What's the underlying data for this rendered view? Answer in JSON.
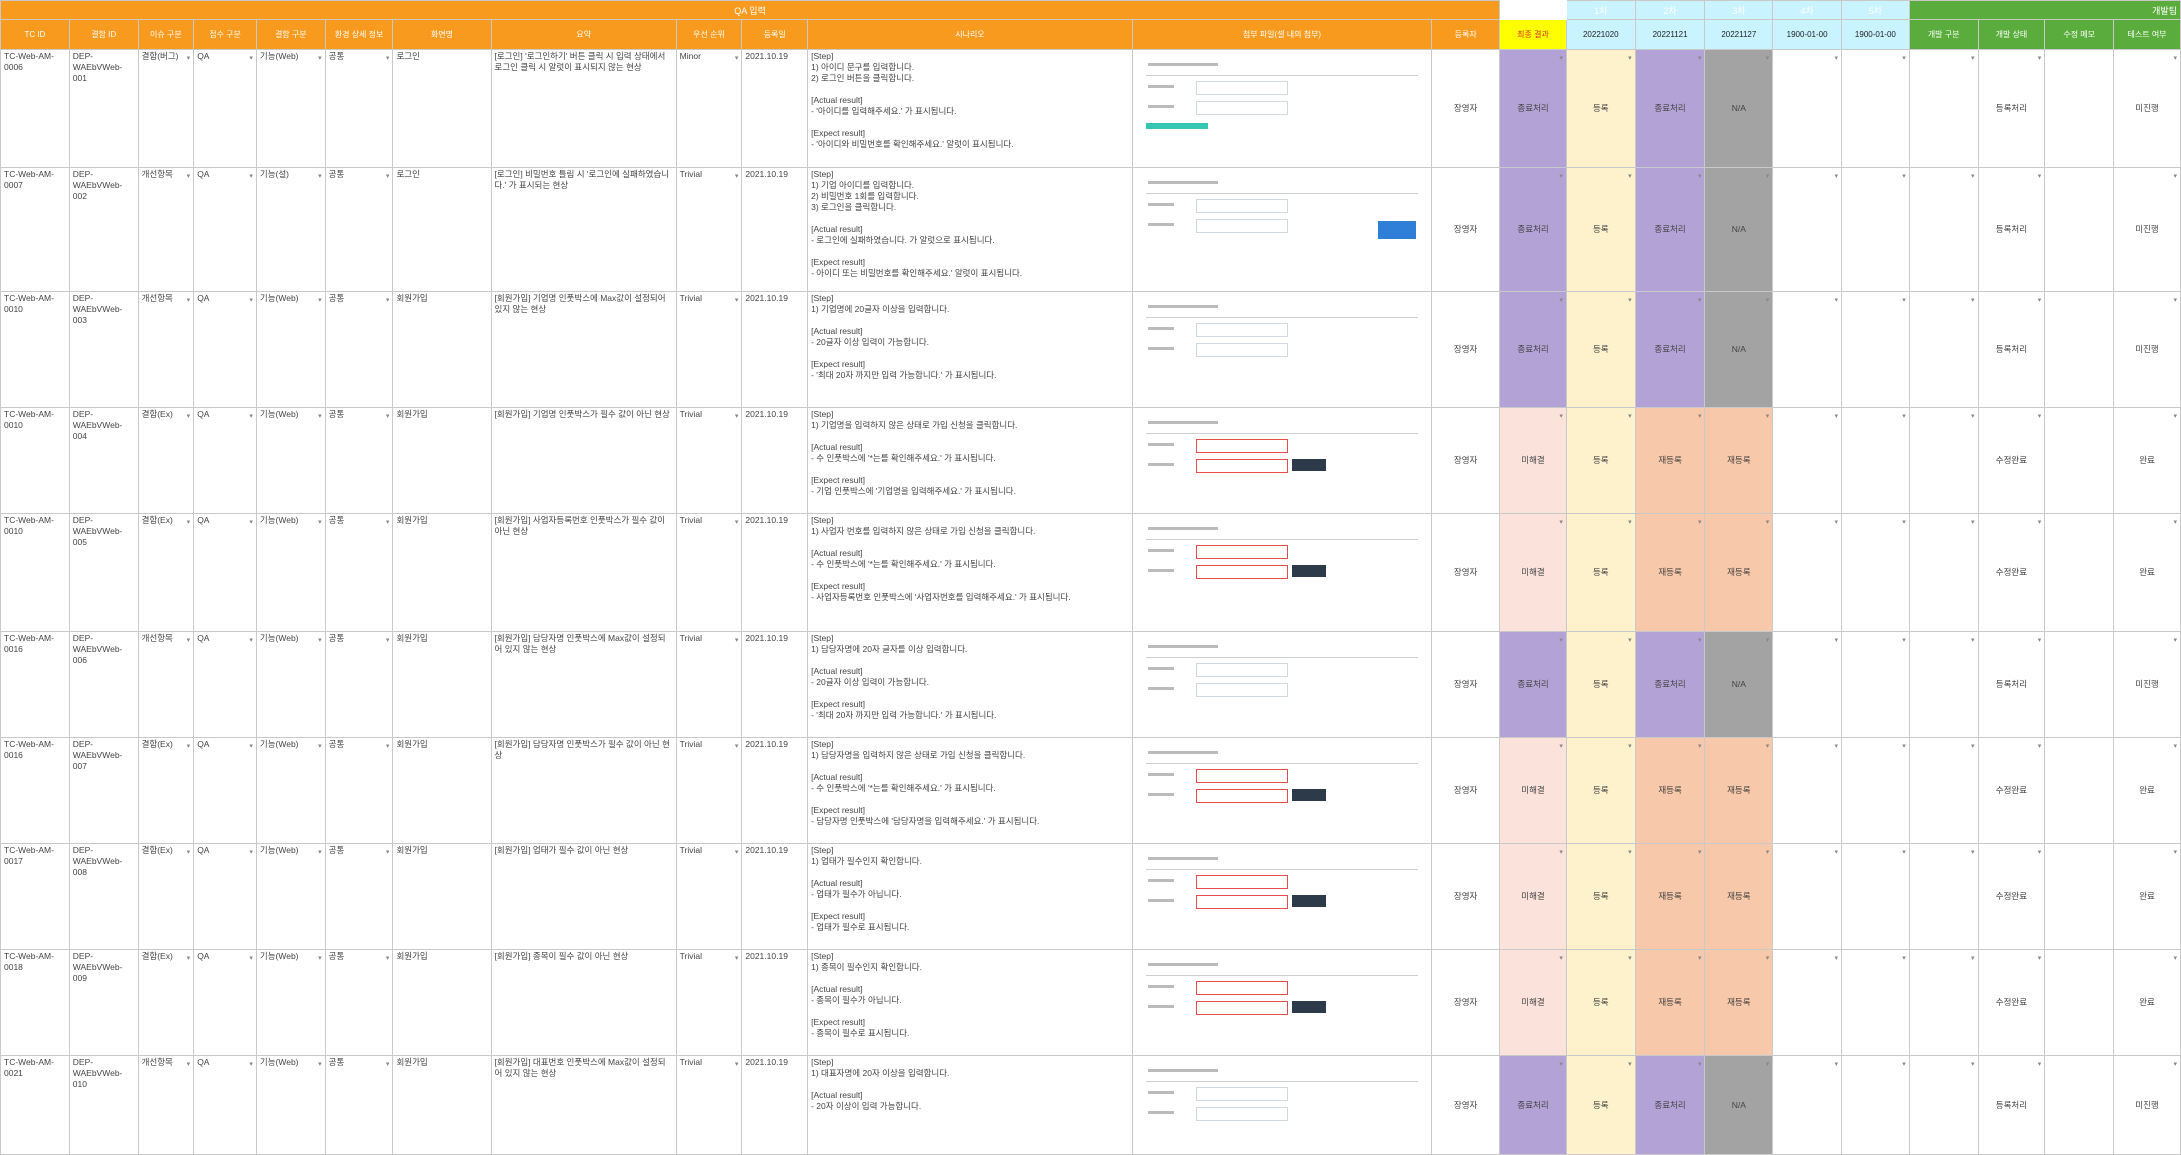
{
  "header": {
    "qa_section": "QA 입력",
    "round1": "1차",
    "round2": "2차",
    "round3": "3차",
    "round4": "4차",
    "round5": "5차",
    "dev_section": "개발팀",
    "cols": {
      "tc_id": "TC ID",
      "req_id": "결함 ID",
      "issue_type": "이슈 구분",
      "source": "접수 구분",
      "device": "결함 구분",
      "env": "환경 상세 정보",
      "screen": "화면명",
      "summary": "요약",
      "priority": "우선 순위",
      "reg_date": "등록일",
      "scenario": "시나리오",
      "attachment": "첨부 파일(셀 내의 첨부)",
      "registrant": "등록자",
      "final_result": "최종 결과",
      "d1": "20221020",
      "d2": "20221121",
      "d3": "20221127",
      "d4": "1900-01-00",
      "d5": "1900-01-00",
      "dev_type": "개발 구분",
      "dev_status": "개발 상태",
      "fix_note": "수정 메모",
      "test_done": "테스트 여부"
    }
  },
  "rows": [
    {
      "tc": "TC-Web-AM-0006",
      "req": "DEP-WAEbVWeb-001",
      "issue": "결함(버그)",
      "src": "QA",
      "dev": "기능(Web)",
      "env": "공통",
      "screen": "로그인",
      "summary": "[로그인] '로그인하기' 버튼 클릭 시 입력 상태에서 로그인 클릭 시 알럿이 표시되지 않는 현상",
      "pri": "Minor",
      "date": "2021.10.19",
      "scenario": "[Step]\n1) 아이디 문구를 입력합니다.\n2) 로그인 버튼을 클릭합니다.\n\n[Actual result]\n- '아이디를 입력해주세요.' 가 표시됩니다.\n\n[Expect result]\n- '아이디와 비밀번호를 확인해주세요.' 알럿이 표시됩니다.",
      "who": "장영자",
      "final": "종료처리",
      "s1": "등록",
      "s2": "종료처리",
      "s3": "N/A",
      "dev_status": "등록처리",
      "test": "미진행",
      "kind": "done"
    },
    {
      "tc": "TC-Web-AM-0007",
      "req": "DEP-WAEbVWeb-002",
      "issue": "개선항목",
      "src": "QA",
      "dev": "기능(설)",
      "env": "공통",
      "screen": "로그인",
      "summary": "[로그인] 비밀번호 틀림 시 '로그인에 실패하였습니다.' 가 표시되는 현상",
      "pri": "Trivial",
      "date": "2021.10.19",
      "scenario": "[Step]\n1) 기업 아이디를 입력합니다.\n2) 비밀번호 1회를 입력합니다.\n3) 로그인을 클릭합니다.\n\n[Actual result]\n- 로그인에 실패하였습니다. 가 알럿으로 표시됩니다.\n\n[Expect result]\n- 아이디 또는 비밀번호를 확인해주세요.' 알럿이 표시됩니다.",
      "who": "장영자",
      "final": "종료처리",
      "s1": "등록",
      "s2": "종료처리",
      "s3": "N/A",
      "dev_status": "등록처리",
      "test": "미진행",
      "kind": "done"
    },
    {
      "tc": "TC-Web-AM-0010",
      "req": "DEP-WAEbVWeb-003",
      "issue": "개선항목",
      "src": "QA",
      "dev": "기능(Web)",
      "env": "공통",
      "screen": "회원가입",
      "summary": "[회원가입] 기업명 인풋박스에 Max값이 설정되어 있지 않는 현상",
      "pri": "Trivial",
      "date": "2021.10.19",
      "scenario": "[Step]\n1) 기업명에 20글자 이상을 입력합니다.\n\n[Actual result]\n- 20글자 이상 입력이 가능합니다.\n\n[Expect result]\n- '최대 20자 까지만 입력 가능합니다.' 가 표시됩니다.",
      "who": "장영자",
      "final": "종료처리",
      "s1": "등록",
      "s2": "종료처리",
      "s3": "N/A",
      "dev_status": "등록처리",
      "test": "미진행",
      "kind": "done"
    },
    {
      "tc": "TC-Web-AM-0010",
      "req": "DEP-WAEbVWeb-004",
      "issue": "결함(Ex)",
      "src": "QA",
      "dev": "기능(Web)",
      "env": "공통",
      "screen": "회원가입",
      "summary": "[회원가입] 기업명 인풋박스가 필수 값이 아닌 현상",
      "pri": "Trivial",
      "date": "2021.10.19",
      "scenario": "[Step]\n1) 기업명을 입력하지 않은 상태로 가입 신청을 클릭합니다.\n\n[Actual result]\n- 수 인풋박스에 '*는를 확인해주세요.' 가 표시됩니다.\n\n[Expect result]\n- 기업 인풋박스에 '기업명을 입력해주세요.' 가 표시됩니다.",
      "who": "장영자",
      "final": "미해결",
      "s1": "등록",
      "s2": "재등록",
      "s3": "재등록",
      "dev_status": "수정완료",
      "test": "완료",
      "kind": "pend"
    },
    {
      "tc": "TC-Web-AM-0010",
      "req": "DEP-WAEbVWeb-005",
      "issue": "결함(Ex)",
      "src": "QA",
      "dev": "기능(Web)",
      "env": "공통",
      "screen": "회원가입",
      "summary": "[회원가입] 사업자등록번호 인풋박스가 필수 값이 아닌 현상",
      "pri": "Trivial",
      "date": "2021.10.19",
      "scenario": "[Step]\n1) 사업자 번호를 입력하지 않은 상태로 가입 신청을 클릭합니다.\n\n[Actual result]\n- 수 인풋박스에 '*는를 확인해주세요.' 가 표시됩니다.\n\n[Expect result]\n- 사업자등록번호 인풋박스에 '사업자번호를 입력해주세요.' 가 표시됩니다.",
      "who": "장영자",
      "final": "미해결",
      "s1": "등록",
      "s2": "재등록",
      "s3": "재등록",
      "dev_status": "수정완료",
      "test": "완료",
      "kind": "pend"
    },
    {
      "tc": "TC-Web-AM-0016",
      "req": "DEP-WAEbVWeb-006",
      "issue": "개선항목",
      "src": "QA",
      "dev": "기능(Web)",
      "env": "공통",
      "screen": "회원가입",
      "summary": "[회원가입] 담당자명 인풋박스에 Max값이 설정되어 있지 않는 현상",
      "pri": "Trivial",
      "date": "2021.10.19",
      "scenario": "[Step]\n1) 담당자명에 20자 글자를 이상 입력합니다.\n\n[Actual result]\n- 20글자 이상 입력이 가능합니다.\n\n[Expect result]\n- '최대 20자 까지만 입력 가능합니다.' 가 표시됩니다.",
      "who": "장영자",
      "final": "종료처리",
      "s1": "등록",
      "s2": "종료처리",
      "s3": "N/A",
      "dev_status": "등록처리",
      "test": "미진행",
      "kind": "done"
    },
    {
      "tc": "TC-Web-AM-0016",
      "req": "DEP-WAEbVWeb-007",
      "issue": "결함(Ex)",
      "src": "QA",
      "dev": "기능(Web)",
      "env": "공통",
      "screen": "회원가입",
      "summary": "[회원가입] 담당자명 인풋박스가 필수 값이 아닌 현상",
      "pri": "Trivial",
      "date": "2021.10.19",
      "scenario": "[Step]\n1) 담당자명을 입력하지 않은 상태로 가입 신청을 클릭합니다.\n\n[Actual result]\n- 수 인풋박스에 '*는를 확인해주세요.' 가 표시됩니다.\n\n[Expect result]\n- 담당자명 인풋박스에 '담당자명을 입력해주세요.' 가 표시됩니다.",
      "who": "장영자",
      "final": "미해결",
      "s1": "등록",
      "s2": "재등록",
      "s3": "재등록",
      "dev_status": "수정완료",
      "test": "완료",
      "kind": "pend"
    },
    {
      "tc": "TC-Web-AM-0017",
      "req": "DEP-WAEbVWeb-008",
      "issue": "결함(Ex)",
      "src": "QA",
      "dev": "기능(Web)",
      "env": "공통",
      "screen": "회원가입",
      "summary": "[회원가입] 업태가 필수 값이 아닌 현상",
      "pri": "Trivial",
      "date": "2021.10.19",
      "scenario": "[Step]\n1) 업태가 필수인지 확인합니다.\n\n[Actual result]\n- 업태가 필수가 아닙니다.\n\n[Expect result]\n- 업태가 필수로 표시됩니다.",
      "who": "장영자",
      "final": "미해결",
      "s1": "등록",
      "s2": "재등록",
      "s3": "재등록",
      "dev_status": "수정완료",
      "test": "완료",
      "kind": "pend"
    },
    {
      "tc": "TC-Web-AM-0018",
      "req": "DEP-WAEbVWeb-009",
      "issue": "결함(Ex)",
      "src": "QA",
      "dev": "기능(Web)",
      "env": "공통",
      "screen": "회원가입",
      "summary": "[회원가입] 종목이 필수 값이 아닌 현상",
      "pri": "Trivial",
      "date": "2021.10.19",
      "scenario": "[Step]\n1) 종목이 필수인지 확인합니다.\n\n[Actual result]\n- 종목이 필수가 아닙니다.\n\n[Expect result]\n- 종목이 필수로 표시됩니다.",
      "who": "장영자",
      "final": "미해결",
      "s1": "등록",
      "s2": "재등록",
      "s3": "재등록",
      "dev_status": "수정완료",
      "test": "완료",
      "kind": "pend"
    },
    {
      "tc": "TC-Web-AM-0021",
      "req": "DEP-WAEbVWeb-010",
      "issue": "개선항목",
      "src": "QA",
      "dev": "기능(Web)",
      "env": "공통",
      "screen": "회원가입",
      "summary": "[회원가입] 대표번호 인풋박스에 Max값이 설정되어 있지 않는 현상",
      "pri": "Trivial",
      "date": "2021.10.19",
      "scenario": "[Step]\n1) 대표자명에 20자 이상을 입력합니다.\n\n[Actual result]\n- 20자 이상이 입력 가능합니다.",
      "who": "장영자",
      "final": "종료처리",
      "s1": "등록",
      "s2": "종료처리",
      "s3": "N/A",
      "dev_status": "등록처리",
      "test": "미진행",
      "kind": "done"
    }
  ]
}
